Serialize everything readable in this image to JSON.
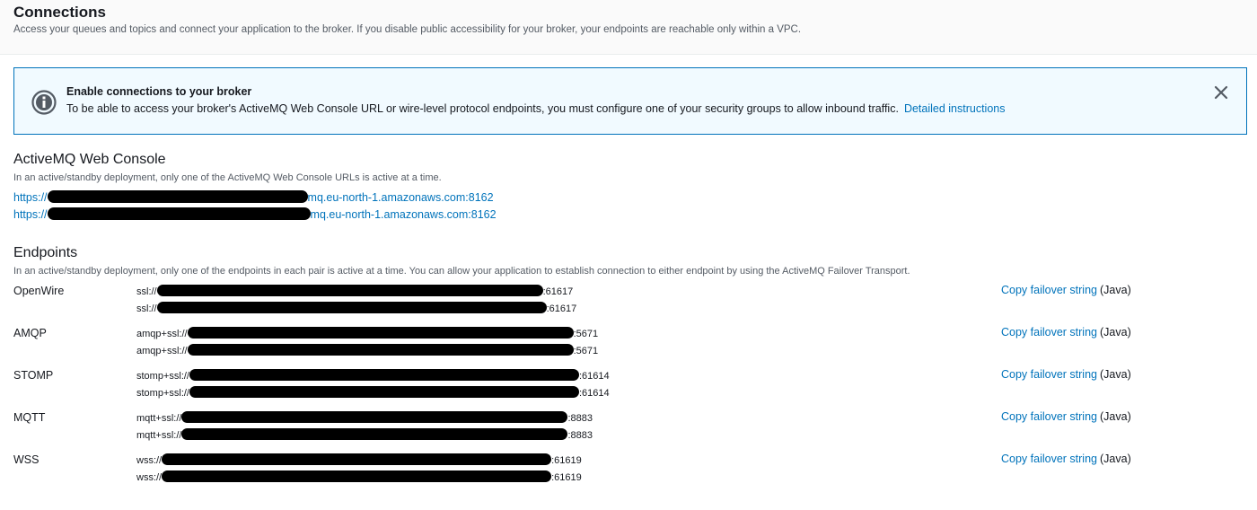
{
  "header": {
    "title": "Connections",
    "description": "Access your queues and topics and connect your application to the broker. If you disable public accessibility for your broker, your endpoints are reachable only within a VPC."
  },
  "alert": {
    "icon": "info-icon",
    "title": "Enable connections to your broker",
    "body": "To be able to access your broker's ActiveMQ Web Console URL or wire-level protocol endpoints, you must configure one of your security groups to allow inbound traffic.",
    "link": "Detailed instructions",
    "close_icon": "close-icon",
    "colors": {
      "border": "#0073bb",
      "background": "#f1faff"
    }
  },
  "web_console": {
    "title": "ActiveMQ Web Console",
    "description": "In an active/standby deployment, only one of the ActiveMQ Web Console URLs is active at a time.",
    "urls": [
      {
        "prefix": "https://",
        "suffix": "mq.eu-north-1.amazonaws.com:8162"
      },
      {
        "prefix": "https://",
        "suffix": "mq.eu-north-1.amazonaws.com:8162"
      }
    ]
  },
  "endpoints": {
    "title": "Endpoints",
    "description": "In an active/standby deployment, only one of the endpoints in each pair is active at a time. You can allow your application to establish connection to either endpoint by using the ActiveMQ Failover Transport.",
    "copy_label": "Copy failover string",
    "copy_suffix": "(Java)",
    "rows": [
      {
        "name": "OpenWire",
        "lines": [
          {
            "prefix": "ssl://",
            "suffix": ":61617"
          },
          {
            "prefix": "ssl://",
            "suffix": ":61617"
          }
        ]
      },
      {
        "name": "AMQP",
        "lines": [
          {
            "prefix": "amqp+ssl://",
            "suffix": ":5671"
          },
          {
            "prefix": "amqp+ssl://",
            "suffix": ":5671"
          }
        ]
      },
      {
        "name": "STOMP",
        "lines": [
          {
            "prefix": "stomp+ssl://",
            "suffix": ":61614"
          },
          {
            "prefix": "stomp+ssl://",
            "suffix": ":61614"
          }
        ]
      },
      {
        "name": "MQTT",
        "lines": [
          {
            "prefix": "mqtt+ssl://",
            "suffix": ":8883"
          },
          {
            "prefix": "mqtt+ssl://",
            "suffix": ":8883"
          }
        ]
      },
      {
        "name": "WSS",
        "lines": [
          {
            "prefix": "wss://",
            "suffix": ":61619"
          },
          {
            "prefix": "wss://",
            "suffix": ":61619"
          }
        ]
      }
    ]
  },
  "colors": {
    "link": "#0073bb",
    "text": "#16191f",
    "muted": "#545b64"
  }
}
